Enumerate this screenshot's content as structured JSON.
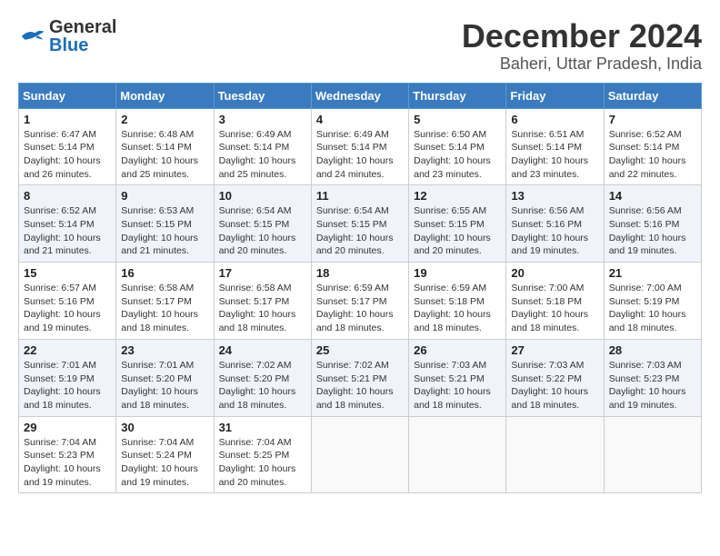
{
  "logo": {
    "line1": "General",
    "line2": "Blue"
  },
  "title": {
    "month": "December 2024",
    "location": "Baheri, Uttar Pradesh, India"
  },
  "weekdays": [
    "Sunday",
    "Monday",
    "Tuesday",
    "Wednesday",
    "Thursday",
    "Friday",
    "Saturday"
  ],
  "weeks": [
    [
      {
        "day": "1",
        "info": "Sunrise: 6:47 AM\nSunset: 5:14 PM\nDaylight: 10 hours\nand 26 minutes."
      },
      {
        "day": "2",
        "info": "Sunrise: 6:48 AM\nSunset: 5:14 PM\nDaylight: 10 hours\nand 25 minutes."
      },
      {
        "day": "3",
        "info": "Sunrise: 6:49 AM\nSunset: 5:14 PM\nDaylight: 10 hours\nand 25 minutes."
      },
      {
        "day": "4",
        "info": "Sunrise: 6:49 AM\nSunset: 5:14 PM\nDaylight: 10 hours\nand 24 minutes."
      },
      {
        "day": "5",
        "info": "Sunrise: 6:50 AM\nSunset: 5:14 PM\nDaylight: 10 hours\nand 23 minutes."
      },
      {
        "day": "6",
        "info": "Sunrise: 6:51 AM\nSunset: 5:14 PM\nDaylight: 10 hours\nand 23 minutes."
      },
      {
        "day": "7",
        "info": "Sunrise: 6:52 AM\nSunset: 5:14 PM\nDaylight: 10 hours\nand 22 minutes."
      }
    ],
    [
      {
        "day": "8",
        "info": "Sunrise: 6:52 AM\nSunset: 5:14 PM\nDaylight: 10 hours\nand 21 minutes."
      },
      {
        "day": "9",
        "info": "Sunrise: 6:53 AM\nSunset: 5:15 PM\nDaylight: 10 hours\nand 21 minutes."
      },
      {
        "day": "10",
        "info": "Sunrise: 6:54 AM\nSunset: 5:15 PM\nDaylight: 10 hours\nand 20 minutes."
      },
      {
        "day": "11",
        "info": "Sunrise: 6:54 AM\nSunset: 5:15 PM\nDaylight: 10 hours\nand 20 minutes."
      },
      {
        "day": "12",
        "info": "Sunrise: 6:55 AM\nSunset: 5:15 PM\nDaylight: 10 hours\nand 20 minutes."
      },
      {
        "day": "13",
        "info": "Sunrise: 6:56 AM\nSunset: 5:16 PM\nDaylight: 10 hours\nand 19 minutes."
      },
      {
        "day": "14",
        "info": "Sunrise: 6:56 AM\nSunset: 5:16 PM\nDaylight: 10 hours\nand 19 minutes."
      }
    ],
    [
      {
        "day": "15",
        "info": "Sunrise: 6:57 AM\nSunset: 5:16 PM\nDaylight: 10 hours\nand 19 minutes."
      },
      {
        "day": "16",
        "info": "Sunrise: 6:58 AM\nSunset: 5:17 PM\nDaylight: 10 hours\nand 18 minutes."
      },
      {
        "day": "17",
        "info": "Sunrise: 6:58 AM\nSunset: 5:17 PM\nDaylight: 10 hours\nand 18 minutes."
      },
      {
        "day": "18",
        "info": "Sunrise: 6:59 AM\nSunset: 5:17 PM\nDaylight: 10 hours\nand 18 minutes."
      },
      {
        "day": "19",
        "info": "Sunrise: 6:59 AM\nSunset: 5:18 PM\nDaylight: 10 hours\nand 18 minutes."
      },
      {
        "day": "20",
        "info": "Sunrise: 7:00 AM\nSunset: 5:18 PM\nDaylight: 10 hours\nand 18 minutes."
      },
      {
        "day": "21",
        "info": "Sunrise: 7:00 AM\nSunset: 5:19 PM\nDaylight: 10 hours\nand 18 minutes."
      }
    ],
    [
      {
        "day": "22",
        "info": "Sunrise: 7:01 AM\nSunset: 5:19 PM\nDaylight: 10 hours\nand 18 minutes."
      },
      {
        "day": "23",
        "info": "Sunrise: 7:01 AM\nSunset: 5:20 PM\nDaylight: 10 hours\nand 18 minutes."
      },
      {
        "day": "24",
        "info": "Sunrise: 7:02 AM\nSunset: 5:20 PM\nDaylight: 10 hours\nand 18 minutes."
      },
      {
        "day": "25",
        "info": "Sunrise: 7:02 AM\nSunset: 5:21 PM\nDaylight: 10 hours\nand 18 minutes."
      },
      {
        "day": "26",
        "info": "Sunrise: 7:03 AM\nSunset: 5:21 PM\nDaylight: 10 hours\nand 18 minutes."
      },
      {
        "day": "27",
        "info": "Sunrise: 7:03 AM\nSunset: 5:22 PM\nDaylight: 10 hours\nand 18 minutes."
      },
      {
        "day": "28",
        "info": "Sunrise: 7:03 AM\nSunset: 5:23 PM\nDaylight: 10 hours\nand 19 minutes."
      }
    ],
    [
      {
        "day": "29",
        "info": "Sunrise: 7:04 AM\nSunset: 5:23 PM\nDaylight: 10 hours\nand 19 minutes."
      },
      {
        "day": "30",
        "info": "Sunrise: 7:04 AM\nSunset: 5:24 PM\nDaylight: 10 hours\nand 19 minutes."
      },
      {
        "day": "31",
        "info": "Sunrise: 7:04 AM\nSunset: 5:25 PM\nDaylight: 10 hours\nand 20 minutes."
      },
      null,
      null,
      null,
      null
    ]
  ]
}
